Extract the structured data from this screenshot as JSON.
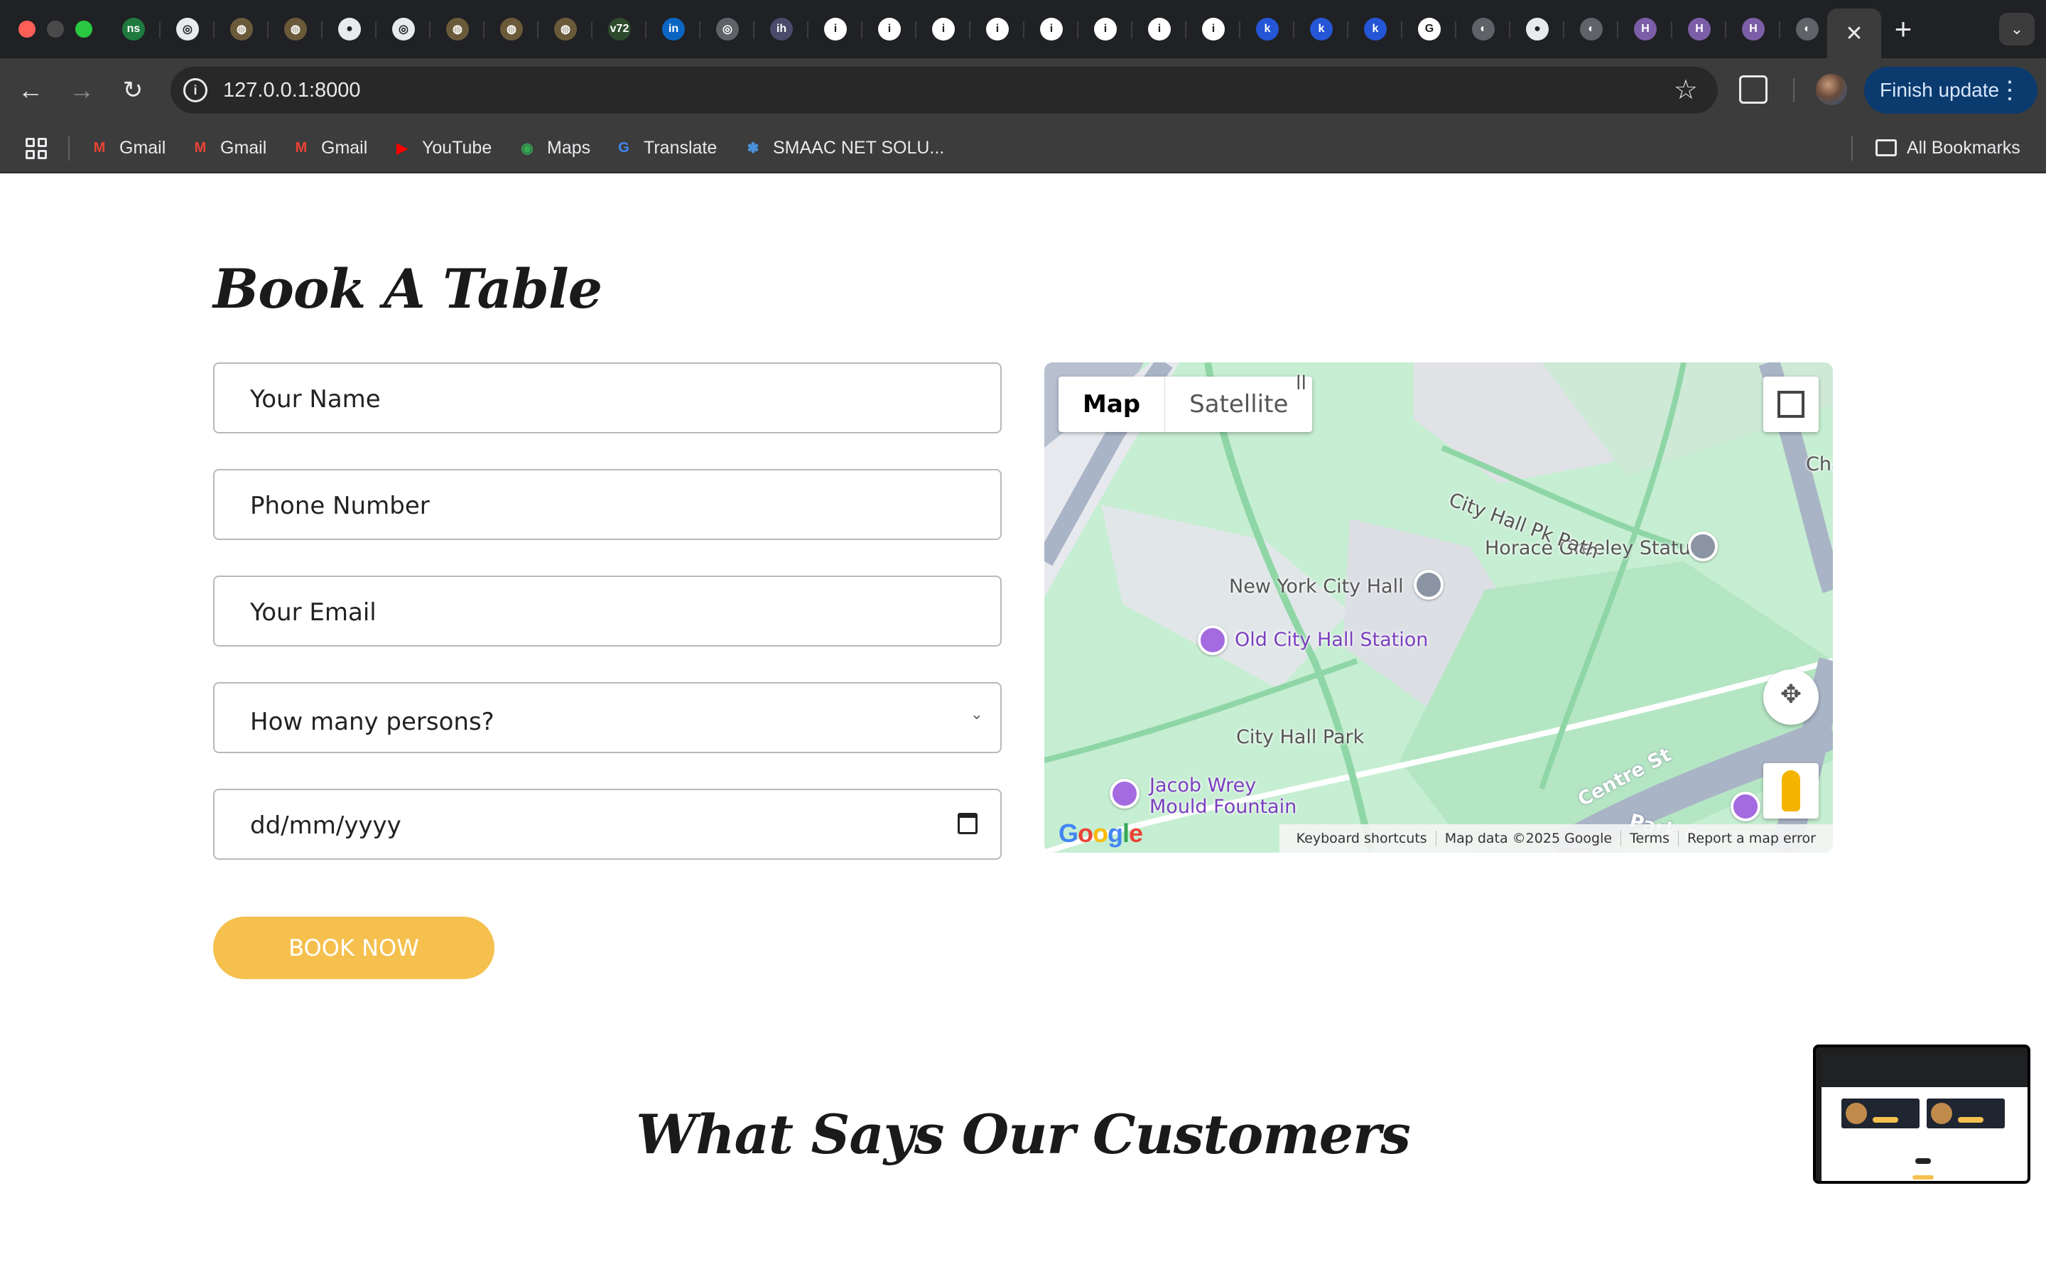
{
  "browser": {
    "tabs": [
      {
        "icon": "ns-icon",
        "glyph": "ns",
        "color": "#1f7a3f"
      },
      {
        "icon": "openai-icon",
        "glyph": "◎",
        "color": "#e8eaed"
      },
      {
        "icon": "ring-icon",
        "glyph": "◍",
        "color": "#6b5a3a"
      },
      {
        "icon": "ring-icon",
        "glyph": "◍",
        "color": "#6b5a3a"
      },
      {
        "icon": "github-icon",
        "glyph": "●",
        "color": "#e8eaed"
      },
      {
        "icon": "openai-icon",
        "glyph": "◎",
        "color": "#e8eaed"
      },
      {
        "icon": "ring-icon",
        "glyph": "◍",
        "color": "#6b5a3a"
      },
      {
        "icon": "ring-icon",
        "glyph": "◍",
        "color": "#6b5a3a"
      },
      {
        "icon": "ring-icon",
        "glyph": "◍",
        "color": "#6b5a3a"
      },
      {
        "icon": "v72-icon",
        "glyph": "v72",
        "color": "#2d4a2d"
      },
      {
        "icon": "linkedin-icon",
        "glyph": "in",
        "color": "#0a66c2"
      },
      {
        "icon": "globe-icon",
        "glyph": "◎",
        "color": "#5f6368"
      },
      {
        "icon": "ih-icon",
        "glyph": "ih",
        "color": "#4a4a6a"
      },
      {
        "icon": "info-icon",
        "glyph": "i",
        "color": "#ffffff"
      },
      {
        "icon": "info-icon",
        "glyph": "i",
        "color": "#ffffff"
      },
      {
        "icon": "info-icon",
        "glyph": "i",
        "color": "#ffffff"
      },
      {
        "icon": "info-icon",
        "glyph": "i",
        "color": "#ffffff"
      },
      {
        "icon": "info-icon",
        "glyph": "i",
        "color": "#ffffff"
      },
      {
        "icon": "info-icon",
        "glyph": "i",
        "color": "#ffffff"
      },
      {
        "icon": "info-icon",
        "glyph": "i",
        "color": "#ffffff"
      },
      {
        "icon": "info-icon",
        "glyph": "i",
        "color": "#ffffff"
      },
      {
        "icon": "k-icon",
        "glyph": "k",
        "color": "#2456d6"
      },
      {
        "icon": "k-icon",
        "glyph": "k",
        "color": "#2456d6"
      },
      {
        "icon": "k-icon",
        "glyph": "k",
        "color": "#2456d6"
      },
      {
        "icon": "google-icon",
        "glyph": "G",
        "color": "#ffffff"
      },
      {
        "icon": "globe-icon",
        "glyph": "◐",
        "color": "#5f6368"
      },
      {
        "icon": "github-icon",
        "glyph": "●",
        "color": "#e8eaed"
      },
      {
        "icon": "globe-icon",
        "glyph": "◐",
        "color": "#5f6368"
      },
      {
        "icon": "h-icon",
        "glyph": "H",
        "color": "#7b5ea7"
      },
      {
        "icon": "h-icon",
        "glyph": "H",
        "color": "#7b5ea7"
      },
      {
        "icon": "h-icon",
        "glyph": "H",
        "color": "#7b5ea7"
      },
      {
        "icon": "globe-icon",
        "glyph": "◐",
        "color": "#5f6368"
      }
    ],
    "url": "127.0.0.1:8000",
    "finish_update": "Finish update",
    "bookmarks": [
      {
        "label": "Gmail",
        "icon": "gmail-icon",
        "glyph": "M",
        "color": "#ea4335"
      },
      {
        "label": "Gmail",
        "icon": "gmail-icon",
        "glyph": "M",
        "color": "#ea4335"
      },
      {
        "label": "Gmail",
        "icon": "gmail-icon",
        "glyph": "M",
        "color": "#ea4335"
      },
      {
        "label": "YouTube",
        "icon": "youtube-icon",
        "glyph": "▶",
        "color": "#ff0000"
      },
      {
        "label": "Maps",
        "icon": "maps-pin-icon",
        "glyph": "◉",
        "color": "#34a853"
      },
      {
        "label": "Translate",
        "icon": "translate-icon",
        "glyph": "G",
        "color": "#4285f4"
      },
      {
        "label": "SMAAC NET SOLU...",
        "icon": "smaac-icon",
        "glyph": "✽",
        "color": "#4a90d9"
      }
    ],
    "all_bookmarks": "All Bookmarks"
  },
  "booking": {
    "title": "Book A Table",
    "fields": {
      "name_placeholder": "Your Name",
      "phone_placeholder": "Phone Number",
      "email_placeholder": "Your Email",
      "persons_placeholder": "How many persons?",
      "date_placeholder": "dd/mm/yyyy"
    },
    "submit_label": "BOOK NOW",
    "accent_color": "#f5c04e"
  },
  "map": {
    "type_map": "Map",
    "type_satellite": "Satellite",
    "labels": {
      "city_hall": "New York City Hall",
      "old_station": "Old City Hall Station",
      "horace": "Horace Greeley Statue",
      "park": "City Hall Park",
      "jacob1": "Jacob Wrey",
      "jacob2": "Mould Fountain",
      "pk_path": "City Hall Pk Path",
      "centre": "Centre St",
      "park_row": "Park R",
      "cha": "Cha",
      "ll": "ll"
    },
    "google": "Google",
    "attribution": [
      "Keyboard shortcuts",
      "Map data ©2025 Google",
      "Terms",
      "Report a map error"
    ]
  },
  "testimonials": {
    "title": "What Says Our Customers"
  }
}
